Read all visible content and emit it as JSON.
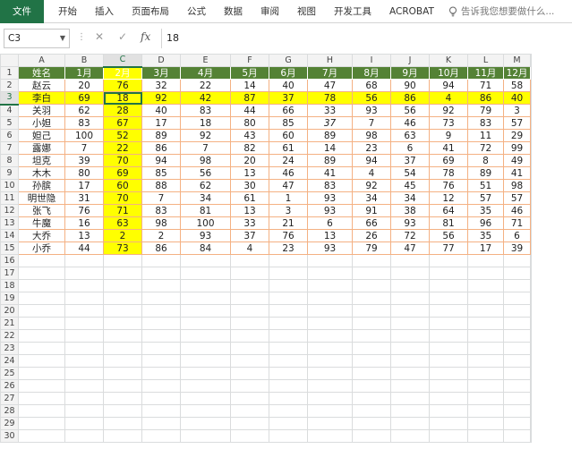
{
  "ribbon": {
    "tabs": [
      "文件",
      "开始",
      "插入",
      "页面布局",
      "公式",
      "数据",
      "审阅",
      "视图",
      "开发工具",
      "ACROBAT"
    ],
    "tell_me": "告诉我您想要做什么..."
  },
  "formula_bar": {
    "name_box": "C3",
    "value": "18"
  },
  "colors": {
    "header_fill": "#548235",
    "highlight": "#ffff00",
    "data_border": "#f4b183",
    "excel_green": "#217346"
  },
  "columns": [
    "A",
    "B",
    "C",
    "D",
    "E",
    "F",
    "G",
    "H",
    "I",
    "J",
    "K",
    "L",
    "M"
  ],
  "row_numbers": [
    "1",
    "2",
    "3",
    "4",
    "5",
    "6",
    "7",
    "8",
    "9",
    "10",
    "11",
    "12",
    "13",
    "14",
    "15",
    "16",
    "17",
    "18",
    "19",
    "20",
    "21",
    "22",
    "23",
    "24",
    "25",
    "26",
    "27",
    "28",
    "29",
    "30"
  ],
  "sheet": {
    "header": [
      "姓名",
      "1月",
      "2月",
      "3月",
      "4月",
      "5月",
      "6月",
      "7月",
      "8月",
      "9月",
      "10月",
      "11月",
      "12月"
    ],
    "rows": [
      [
        "赵云",
        "20",
        "76",
        "32",
        "22",
        "14",
        "40",
        "47",
        "68",
        "90",
        "94",
        "71",
        "58"
      ],
      [
        "李白",
        "69",
        "18",
        "92",
        "42",
        "87",
        "37",
        "78",
        "56",
        "86",
        "4",
        "86",
        "40"
      ],
      [
        "关羽",
        "62",
        "28",
        "40",
        "83",
        "44",
        "66",
        "33",
        "93",
        "56",
        "92",
        "79",
        "3"
      ],
      [
        "小妲",
        "83",
        "67",
        "17",
        "18",
        "80",
        "85",
        "37",
        "7",
        "46",
        "73",
        "83",
        "57"
      ],
      [
        "妲己",
        "100",
        "52",
        "89",
        "92",
        "43",
        "60",
        "89",
        "98",
        "63",
        "9",
        "11",
        "29"
      ],
      [
        "露娜",
        "7",
        "22",
        "86",
        "7",
        "82",
        "61",
        "14",
        "23",
        "6",
        "41",
        "72",
        "99"
      ],
      [
        "坦克",
        "39",
        "70",
        "94",
        "98",
        "20",
        "24",
        "89",
        "94",
        "37",
        "69",
        "8",
        "49"
      ],
      [
        "木木",
        "80",
        "69",
        "85",
        "56",
        "13",
        "46",
        "41",
        "4",
        "54",
        "78",
        "89",
        "41"
      ],
      [
        "孙膑",
        "17",
        "60",
        "88",
        "62",
        "30",
        "47",
        "83",
        "92",
        "45",
        "76",
        "51",
        "98"
      ],
      [
        "明世隐",
        "31",
        "70",
        "7",
        "34",
        "61",
        "1",
        "93",
        "34",
        "34",
        "12",
        "57",
        "57"
      ],
      [
        "张飞",
        "76",
        "71",
        "83",
        "81",
        "13",
        "3",
        "93",
        "91",
        "38",
        "64",
        "35",
        "46"
      ],
      [
        "牛魔",
        "16",
        "63",
        "98",
        "100",
        "33",
        "21",
        "6",
        "66",
        "93",
        "81",
        "96",
        "71"
      ],
      [
        "大乔",
        "13",
        "2",
        "2",
        "93",
        "37",
        "76",
        "13",
        "26",
        "72",
        "56",
        "35",
        "6"
      ],
      [
        "小乔",
        "44",
        "73",
        "86",
        "84",
        "4",
        "23",
        "93",
        "79",
        "47",
        "77",
        "17",
        "39"
      ]
    ]
  }
}
